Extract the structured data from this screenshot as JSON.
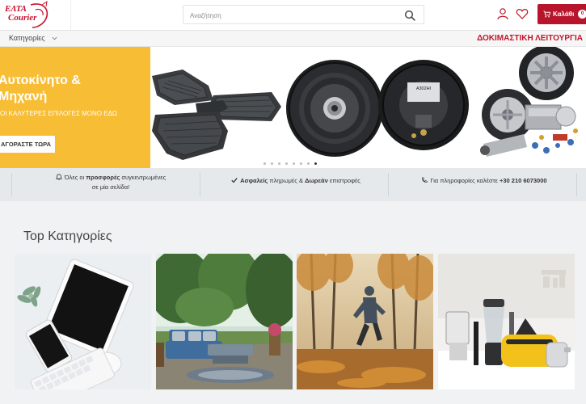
{
  "header": {
    "logo_line1": "ΕΛΤΑ",
    "logo_line2": "Courier",
    "search_placeholder": "Αναζήτηση",
    "cart_label": "Καλάθι",
    "cart_count": "0"
  },
  "subnav": {
    "categories_label": "Κατηγορίες",
    "test_mode": "ΔΟΚΙΜΑΣΤΙΚΗ ΛΕΙΤΟΥΡΓΙΑ"
  },
  "hero": {
    "title_line1": "Αυτοκίνητο &",
    "title_line2": "Μηχανή",
    "subtitle": "ΟΙ ΚΑΛΥΤΕΡΕΣ ΕΠΙΛΟΓΕΣ ΜΟΝΟ ΕΔΩ",
    "cta": "ΑΓΟΡΑΣΤΕ ΤΩΡΑ",
    "speaker_brand": "A302HI",
    "slide_count": 8,
    "active_slide": 8
  },
  "features": {
    "offers_pre": "Όλες οι ",
    "offers_bold": "προσφορές",
    "offers_post": " συγκεντρωμένες",
    "offers_line2": "σε μία σελίδα!",
    "secure_bold": "Ασφαλείς",
    "secure_mid": " πληρωμές & ",
    "secure_bold2": "Δωρεάν",
    "secure_post": " επιστροφές",
    "info_pre": "Για πληροφορίες καλέστε ",
    "info_phone": "+30 210 6073000"
  },
  "top_categories": {
    "title": "Top Κατηγορίες",
    "cards": [
      {
        "icon": "tablet-phone-keyboard"
      },
      {
        "icon": "garden-furniture"
      },
      {
        "icon": "runner-autumn"
      },
      {
        "icon": "kitchen-appliances"
      }
    ]
  },
  "colors": {
    "brand_red": "#b8142b",
    "hero_yellow": "#f7bd34",
    "features_bg": "#e5e9ec"
  }
}
